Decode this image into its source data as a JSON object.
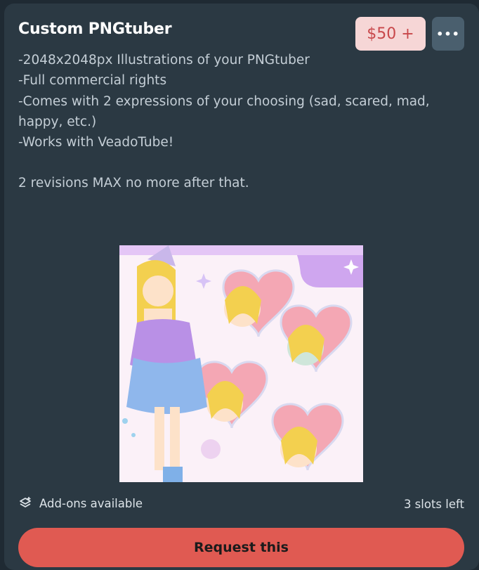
{
  "card": {
    "title": "Custom PNGtuber",
    "price": "$50 +",
    "description_lines": [
      "-2048x2048px Illustrations of your PNGtuber",
      "-Full commercial rights",
      "-Comes with 2 expressions of your choosing (sad, scared, mad,",
      "happy, etc.)",
      "-Works with VeadoTube!",
      "",
      "2 revisions MAX no more after that."
    ],
    "addons_label": "Add-ons available",
    "slots_label": "3 slots left",
    "request_label": "Request this",
    "icons": {
      "more": "ellipsis-icon",
      "addons": "layers-plus-icon"
    },
    "colors": {
      "accent": "#e05a52",
      "price_bg": "#f6d6d6",
      "price_text": "#c8474a",
      "card_bg": "#2b3943"
    }
  }
}
